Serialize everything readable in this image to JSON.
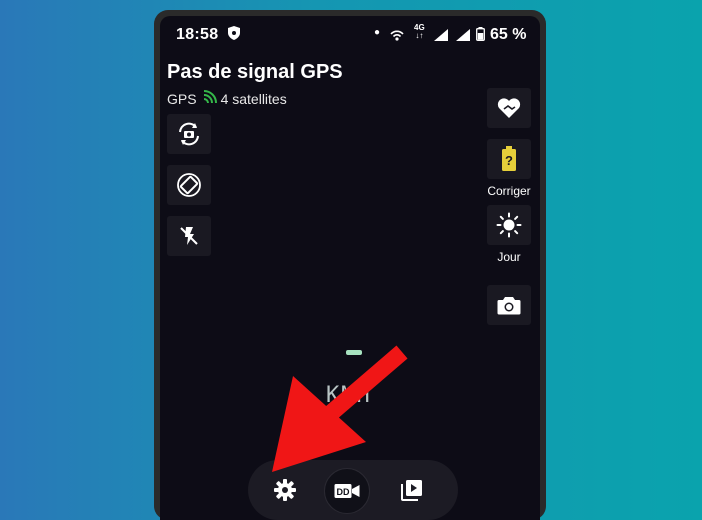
{
  "status_bar": {
    "time": "18:58",
    "network_type": "4G",
    "battery": "65 %"
  },
  "gps": {
    "title": "Pas de signal GPS",
    "label": "GPS",
    "satellites": "4 satellites"
  },
  "right_panel": {
    "fix_label": "Corriger",
    "day_label": "Jour"
  },
  "speed": {
    "unit": "KMH"
  },
  "icons": {
    "left": [
      "rotate-camera-icon",
      "screen-rotation-icon",
      "flash-off-icon"
    ],
    "right": [
      "heart-hands-icon",
      "battery-unknown-icon",
      "sun-icon",
      "camera-icon"
    ],
    "bottom": [
      "settings-icon",
      "dashcam-icon",
      "video-library-icon"
    ]
  },
  "colors": {
    "background_left": "#2a78b8",
    "background_right": "#0aa3ad",
    "screen": "#0d0c16",
    "arrow": "#f01616",
    "speed_mark": "#a8e3c0"
  }
}
